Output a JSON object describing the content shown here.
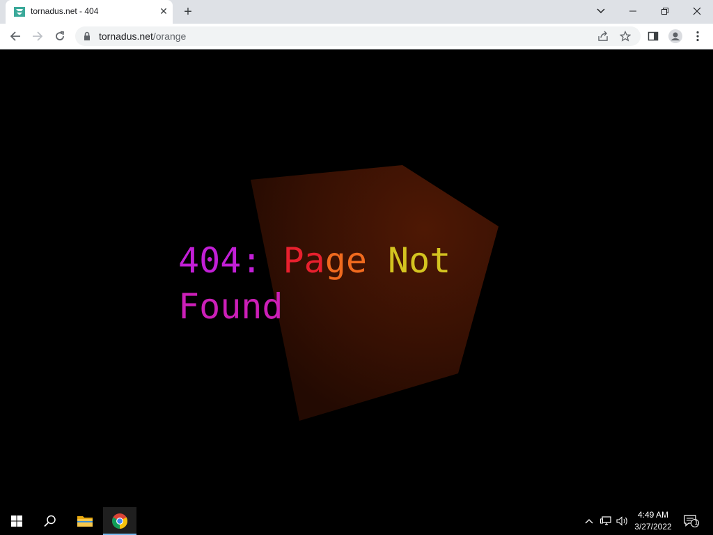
{
  "browser": {
    "tab": {
      "title": "tornadus.net - 404",
      "close_glyph": "✕",
      "favicon": "tornadus-favicon-icon"
    },
    "new_tab_glyph": "+",
    "window_controls": {
      "tab_search_glyph": "⌄",
      "minimize_glyph": "—",
      "restore_glyph": "❐",
      "close_glyph": "✕"
    },
    "address": {
      "host": "tornadus.net",
      "path": "/orange"
    }
  },
  "page": {
    "heading_parts": [
      {
        "text": "404: ",
        "color": "#c21fd6"
      },
      {
        "text": "Pa",
        "color": "#e8202e"
      },
      {
        "text": "ge",
        "color": "#f06a1e"
      },
      {
        "text": " Not",
        "color": "#d4c420"
      },
      {
        "text": "Found",
        "color": "#cc1fb8"
      }
    ],
    "cube_color": "#3a1204"
  },
  "taskbar": {
    "time": "4:49 AM",
    "date": "3/27/2022",
    "notification_count": "1",
    "accent_color": "#76b9ed"
  }
}
